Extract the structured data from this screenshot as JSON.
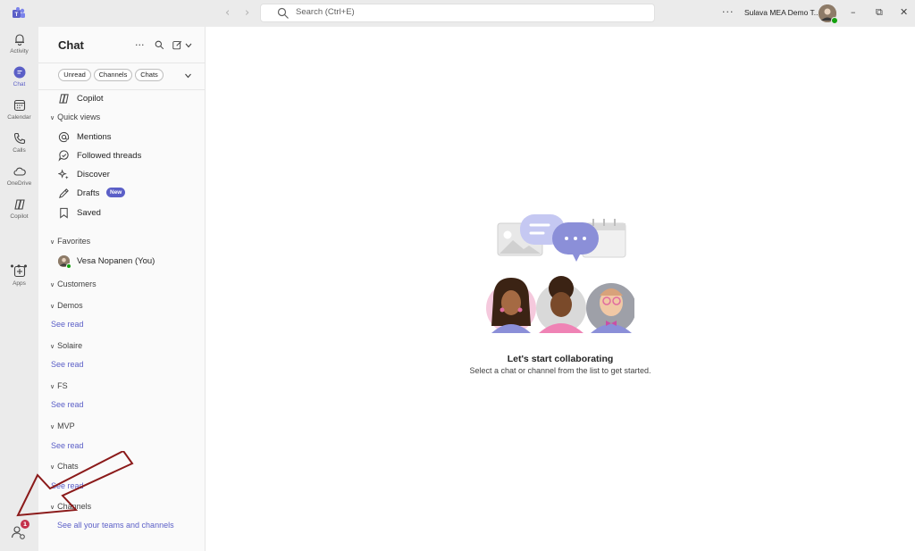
{
  "titlebar": {
    "search_placeholder": "Search (Ctrl+E)",
    "more": "···",
    "org_name": "Sulava MEA Demo T...",
    "minimize": "–",
    "restore": "⧉",
    "close": "✕",
    "back": "‹",
    "forward": "›"
  },
  "rail": {
    "items": [
      {
        "label": "Activity",
        "icon": "bell-icon"
      },
      {
        "label": "Chat",
        "icon": "chat-icon"
      },
      {
        "label": "Calendar",
        "icon": "calendar-icon"
      },
      {
        "label": "Calls",
        "icon": "phone-icon"
      },
      {
        "label": "OneDrive",
        "icon": "cloud-icon"
      },
      {
        "label": "Copilot",
        "icon": "copilot-icon"
      },
      {
        "label": "Apps",
        "icon": "apps-icon"
      }
    ],
    "more": "•••",
    "badge_count": "1"
  },
  "sidebar": {
    "title": "Chat",
    "more": "···",
    "filters": [
      "Unread",
      "Channels",
      "Chats"
    ],
    "copilot": "Copilot",
    "quick_views_header": "Quick views",
    "quick_views": [
      {
        "label": "Mentions",
        "icon": "at-icon"
      },
      {
        "label": "Followed threads",
        "icon": "followed-threads-icon"
      },
      {
        "label": "Discover",
        "icon": "sparkle-icon"
      },
      {
        "label": "Drafts",
        "icon": "pencil-icon",
        "badge": "New"
      },
      {
        "label": "Saved",
        "icon": "bookmark-icon"
      }
    ],
    "favorites_header": "Favorites",
    "favorite_contact": "Vesa Nopanen (You)",
    "sections": [
      {
        "name": "Customers"
      },
      {
        "name": "Demos",
        "see_read": "See read"
      },
      {
        "name": "Solaire",
        "see_read": "See read"
      },
      {
        "name": "FS",
        "see_read": "See read"
      },
      {
        "name": "MVP",
        "see_read": "See read"
      },
      {
        "name": "Chats",
        "see_read": "See read"
      },
      {
        "name": "Channels"
      }
    ],
    "see_all": "See all your teams and channels"
  },
  "main": {
    "title": "Let's start collaborating",
    "subtitle": "Select a chat or channel from the list to get started."
  },
  "colors": {
    "accent": "#5b5fc7",
    "badge": "#c4314b",
    "presence": "#13a10e",
    "arrow": "#8b1a1a"
  }
}
